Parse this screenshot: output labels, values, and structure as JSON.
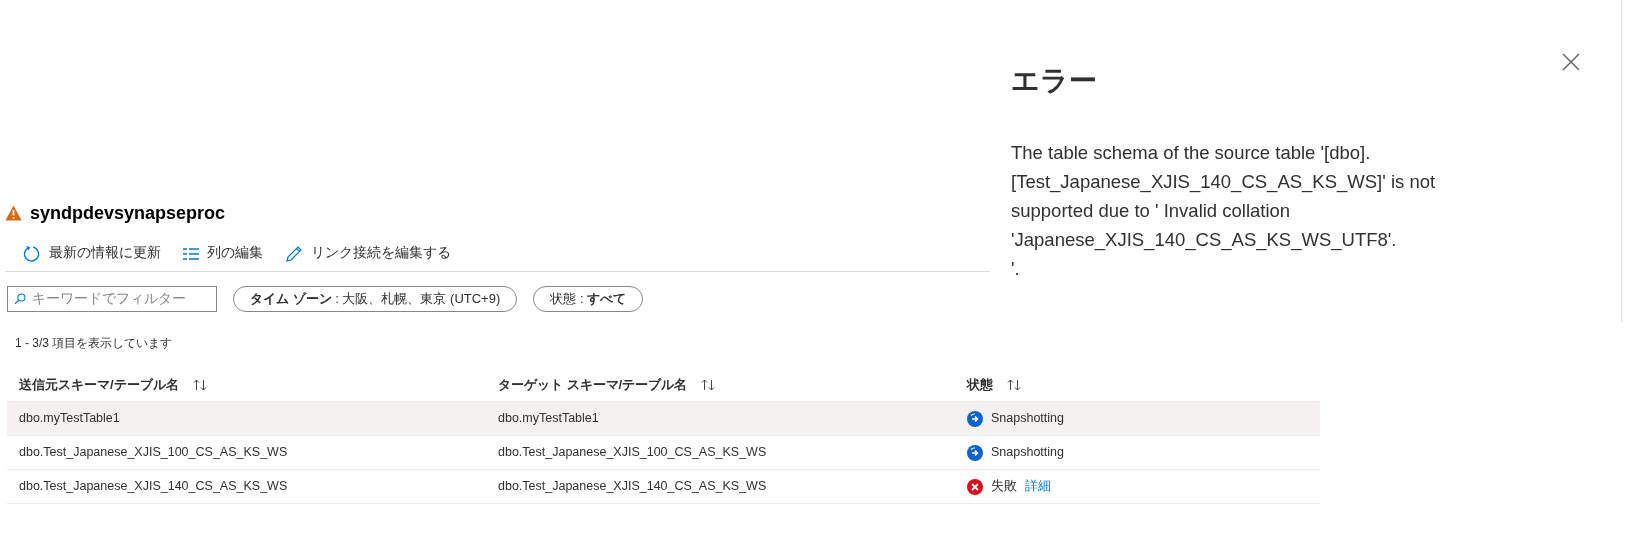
{
  "page": {
    "title": "syndpdevsynapseproc",
    "toolbar": [
      {
        "kind": "refresh",
        "label": "最新の情報に更新"
      },
      {
        "kind": "columns",
        "label": "列の編集"
      },
      {
        "kind": "edit",
        "label": "リンク接続を編集する"
      }
    ],
    "search": {
      "placeholder": "キーワードでフィルター"
    },
    "filters": [
      "**タイム ゾーン** : 大阪、札幌、東京 (UTC+9)",
      "状態 : **すべて**"
    ],
    "count": "1 - 3/3 項目を表示しています",
    "table": {
      "columns": [
        "送信元スキーマ/テーブル名",
        "ターゲット スキーマ/テーブル名",
        "状態"
      ],
      "rows": [
        {
          "selected": true,
          "source": "dbo.myTestTable1",
          "target": "dbo.myTestTable1",
          "status": {
            "kind": "syncing",
            "text": "Snapshotting"
          }
        },
        {
          "selected": false,
          "source": "dbo.Test_Japanese_XJIS_100_CS_AS_KS_WS",
          "target": "dbo.Test_Japanese_XJIS_100_CS_AS_KS_WS",
          "status": {
            "kind": "syncing",
            "text": "Snapshotting"
          }
        },
        {
          "selected": false,
          "source": "dbo.Test_Japanese_XJIS_140_CS_AS_KS_WS",
          "target": "dbo.Test_Japanese_XJIS_140_CS_AS_KS_WS",
          "status": {
            "kind": "failed",
            "text": "失敗",
            "link": "詳細"
          }
        }
      ]
    }
  },
  "error_panel": {
    "title": "エラー",
    "message": "The table schema of the source table '[dbo].\n[Test_Japanese_XJIS_140_CS_AS_KS_WS]' is not\nsupported due to ' Invalid collation\n'Japanese_XJIS_140_CS_AS_KS_WS_UTF8'.\n'."
  }
}
